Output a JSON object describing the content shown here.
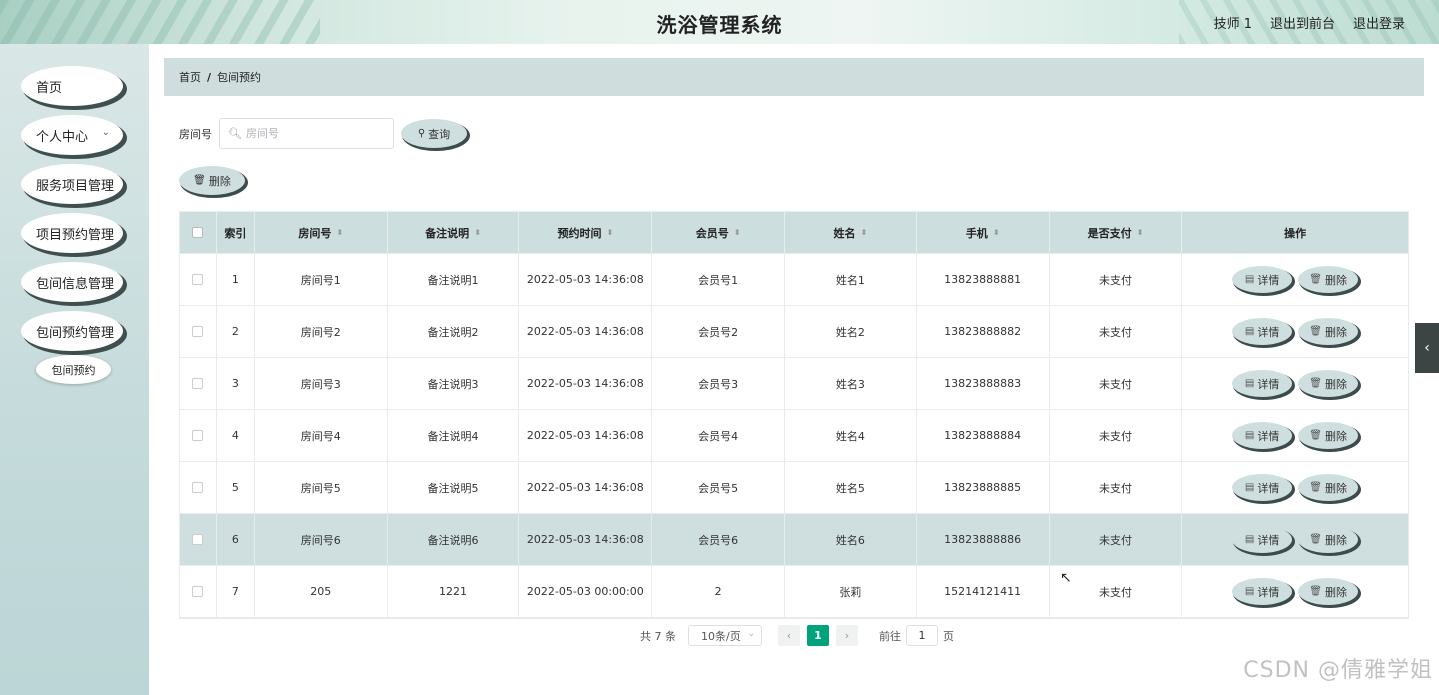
{
  "header": {
    "title": "洗浴管理系统",
    "user": "技师 1",
    "to_front": "退出到前台",
    "logout": "退出登录"
  },
  "sidebar": {
    "items": [
      {
        "label": "首页"
      },
      {
        "label": "个人中心"
      },
      {
        "label": "服务项目管理"
      },
      {
        "label": "项目预约管理"
      },
      {
        "label": "包间信息管理"
      },
      {
        "label": "包间预约管理"
      }
    ],
    "sub_item": "包间预约"
  },
  "breadcrumb": {
    "home": "首页",
    "current": "包间预约"
  },
  "search": {
    "label": "房间号",
    "placeholder": "房间号",
    "query_button": "查询"
  },
  "toolbar": {
    "delete_button": "删除"
  },
  "table": {
    "columns": [
      "索引",
      "房间号",
      "备注说明",
      "预约时间",
      "会员号",
      "姓名",
      "手机",
      "是否支付",
      "操作"
    ],
    "rows": [
      {
        "idx": "1",
        "room": "房间号1",
        "note": "备注说明1",
        "time": "2022-05-03 14:36:08",
        "member": "会员号1",
        "name": "姓名1",
        "phone": "13823888881",
        "paid": "未支付"
      },
      {
        "idx": "2",
        "room": "房间号2",
        "note": "备注说明2",
        "time": "2022-05-03 14:36:08",
        "member": "会员号2",
        "name": "姓名2",
        "phone": "13823888882",
        "paid": "未支付"
      },
      {
        "idx": "3",
        "room": "房间号3",
        "note": "备注说明3",
        "time": "2022-05-03 14:36:08",
        "member": "会员号3",
        "name": "姓名3",
        "phone": "13823888883",
        "paid": "未支付"
      },
      {
        "idx": "4",
        "room": "房间号4",
        "note": "备注说明4",
        "time": "2022-05-03 14:36:08",
        "member": "会员号4",
        "name": "姓名4",
        "phone": "13823888884",
        "paid": "未支付"
      },
      {
        "idx": "5",
        "room": "房间号5",
        "note": "备注说明5",
        "time": "2022-05-03 14:36:08",
        "member": "会员号5",
        "name": "姓名5",
        "phone": "13823888885",
        "paid": "未支付"
      },
      {
        "idx": "6",
        "room": "房间号6",
        "note": "备注说明6",
        "time": "2022-05-03 14:36:08",
        "member": "会员号6",
        "name": "姓名6",
        "phone": "13823888886",
        "paid": "未支付"
      },
      {
        "idx": "7",
        "room": "205",
        "note": "1221",
        "time": "2022-05-03 00:00:00",
        "member": "2",
        "name": "张莉",
        "phone": "15214121411",
        "paid": "未支付"
      }
    ],
    "detail_label": "详情",
    "delete_label": "删除"
  },
  "pagination": {
    "total": "共 7 条",
    "page_size": "10条/页",
    "current_page": "1",
    "goto_label": "前往",
    "goto_value": "1",
    "page_unit": "页"
  },
  "watermark": "CSDN @倩雅学姐",
  "colors": {
    "accent": "#00a37c",
    "table_header": "#cddedf",
    "sidebar": "#c4dadb"
  }
}
